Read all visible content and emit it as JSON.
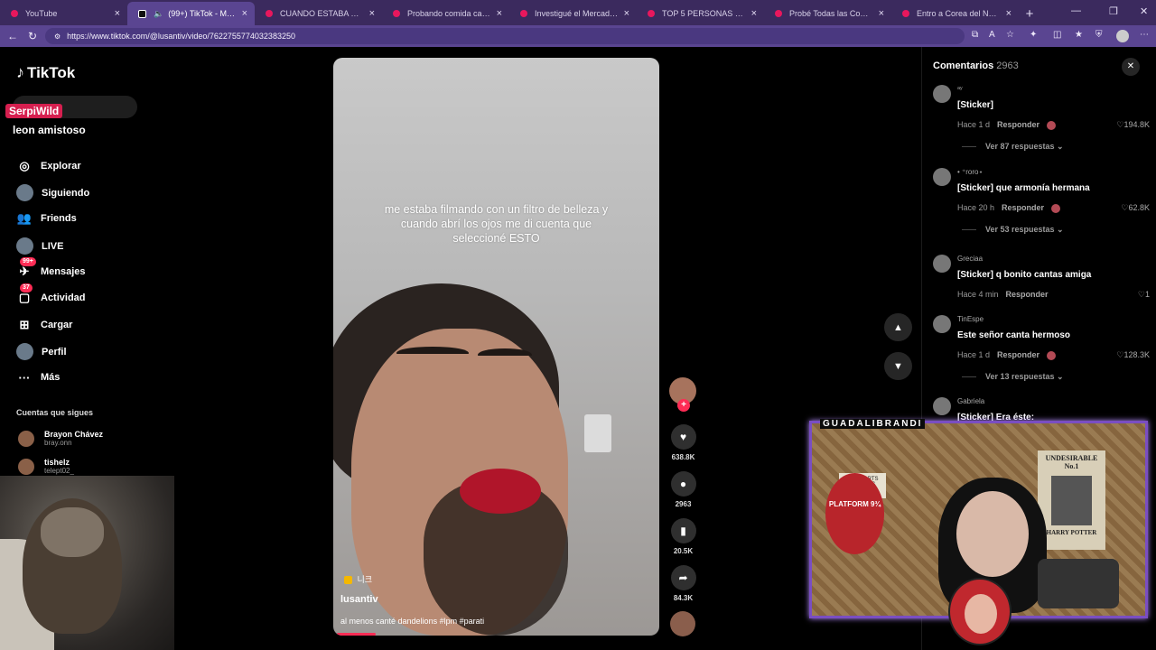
{
  "browser": {
    "tabs": [
      {
        "title": "YouTube",
        "active": false,
        "tiktok": false
      },
      {
        "title": "(99+) TikTok - Make Your",
        "active": true,
        "tiktok": true
      },
      {
        "title": "CUANDO ESTABA VIVA a NA",
        "active": false,
        "tiktok": false
      },
      {
        "title": "Probando comida callejera er",
        "active": false,
        "tiktok": false
      },
      {
        "title": "Investigué el Mercado de Ar",
        "active": false,
        "tiktok": false
      },
      {
        "title": "TOP 5 PERSONAS DESINFOR",
        "active": false,
        "tiktok": false
      },
      {
        "title": "Probé Todas las Comidas XX",
        "active": false,
        "tiktok": false
      },
      {
        "title": "Entro a Corea del Norte - Yo",
        "active": false,
        "tiktok": false
      }
    ],
    "url": "https://www.tiktok.com/@lusantiv/video/7622755774032383250"
  },
  "sidebar": {
    "logo": "TikTok",
    "streamer_badge": "SerpiWild",
    "chat_name": "leon amistoso",
    "nav": [
      {
        "label": "Explorar",
        "icon": "compass-icon",
        "glyph": "◎"
      },
      {
        "label": "Siguiendo",
        "icon": "following-avatar-icon",
        "glyph": ""
      },
      {
        "label": "Friends",
        "icon": "friends-icon",
        "glyph": "👥"
      },
      {
        "label": "LIVE",
        "icon": "live-avatar-icon",
        "glyph": ""
      },
      {
        "label": "Mensajes",
        "icon": "messages-icon",
        "glyph": "✈",
        "badge": "99+"
      },
      {
        "label": "Actividad",
        "icon": "activity-icon",
        "glyph": "▢",
        "badge": "37"
      },
      {
        "label": "Cargar",
        "icon": "upload-icon",
        "glyph": "⊞"
      },
      {
        "label": "Perfil",
        "icon": "profile-avatar-icon",
        "glyph": ""
      },
      {
        "label": "Más",
        "icon": "more-icon",
        "glyph": "···"
      }
    ],
    "following_header": "Cuentas que sigues",
    "following": [
      {
        "name": "Brayon Chávez",
        "handle": "bray.onn"
      },
      {
        "name": "tishelz",
        "handle": "telept02_"
      }
    ]
  },
  "video": {
    "caption": "me estaba filmando con un filtro de belleza y cuando abrí los ojos me di cuenta que seleccioné ESTO",
    "sticker_tag": "니크",
    "author": "lusantiv",
    "description": "al menos canté dandelions #lpm #parati",
    "progress": 0.12
  },
  "actions": {
    "likes": "638.8K",
    "comments": "2963",
    "saves": "20.5K",
    "shares": "84.3K"
  },
  "comments_panel": {
    "title": "Comentarios",
    "count": "2963",
    "items": [
      {
        "user": "ᵃʸ",
        "text": "[Sticker]",
        "time": "Hace 1 d",
        "reply": "Responder",
        "likes": "♡194.8K",
        "more": "Ver 87 respuestas ⌄",
        "liked_by_creator": true
      },
      {
        "user": "• ⁺roro⋆",
        "text": "[Sticker] que armonía hermana",
        "time": "Hace 20 h",
        "reply": "Responder",
        "likes": "♡62.8K",
        "more": "Ver 53 respuestas ⌄",
        "liked_by_creator": true
      },
      {
        "user": "Greciaa",
        "text": "[Sticker] q bonito cantas amiga",
        "time": "Hace 4 min",
        "reply": "Responder",
        "likes": "♡1",
        "more": "",
        "liked_by_creator": false
      },
      {
        "user": "TinEspe",
        "text": "Este señor canta hermoso",
        "time": "Hace 1 d",
        "reply": "Responder",
        "likes": "♡128.3K",
        "more": "Ver 13 respuestas ⌄",
        "liked_by_creator": true
      },
      {
        "user": "Gabriela",
        "text": "[Sticker] Era éste:",
        "time": "",
        "reply": "",
        "likes": "",
        "more": "",
        "liked_by_creator": false
      }
    ]
  },
  "overlay": {
    "cam_title": "GUADALIBRANDI",
    "poster_text": "UNDESIRABLE No.1",
    "poster_name": "HARRY POTTER",
    "platform_text": "PLATFORM 9¾",
    "hogwarts_text": "HOGWARTS EXPRESS"
  },
  "colors": {
    "accent": "#fe2c55",
    "browser": "#5a4591",
    "cam_border": "#7a4ec2"
  }
}
